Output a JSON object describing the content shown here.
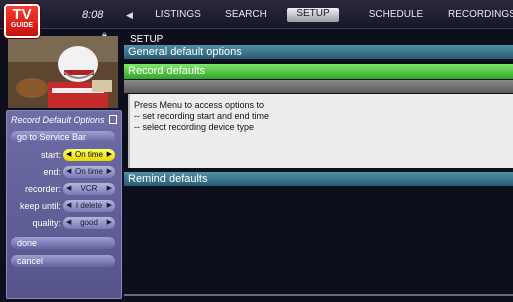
{
  "logo": {
    "line1": "TV",
    "line2": "GUIDE"
  },
  "header": {
    "time": "8:08",
    "prev_icon": "triangle-left-icon"
  },
  "nav": {
    "tabs": [
      {
        "label": "LISTINGS"
      },
      {
        "label": "SEARCH"
      },
      {
        "label": "SETUP",
        "active": true
      },
      {
        "label": "SCHEDULE"
      },
      {
        "label": "RECORDINGS"
      }
    ]
  },
  "side_panel": {
    "title": "Record Default Options",
    "service_bar_button": "go to Service Bar",
    "fields": [
      {
        "label": "start:",
        "value": "On time",
        "highlighted": true
      },
      {
        "label": "end:",
        "value": "On time"
      },
      {
        "label": "recorder:",
        "value": "VCR"
      },
      {
        "label": "keep until:",
        "value": "I delete"
      },
      {
        "label": "quality:",
        "value": "good"
      }
    ],
    "done_button": "done",
    "cancel_button": "cancel"
  },
  "main": {
    "heading": "SETUP",
    "general_bar": "General default options",
    "record_bar": "Record defaults",
    "info_lines": [
      "Press Menu to access options to",
      "-- set recording start and end time",
      "-- select recording device type"
    ],
    "remind_bar": "Remind defaults"
  },
  "colors": {
    "record_bar": "#33a528",
    "section_bar": "#2a5c72",
    "highlight": "#e6d800",
    "panel": "#6e6da6",
    "logo": "#c4120c"
  }
}
